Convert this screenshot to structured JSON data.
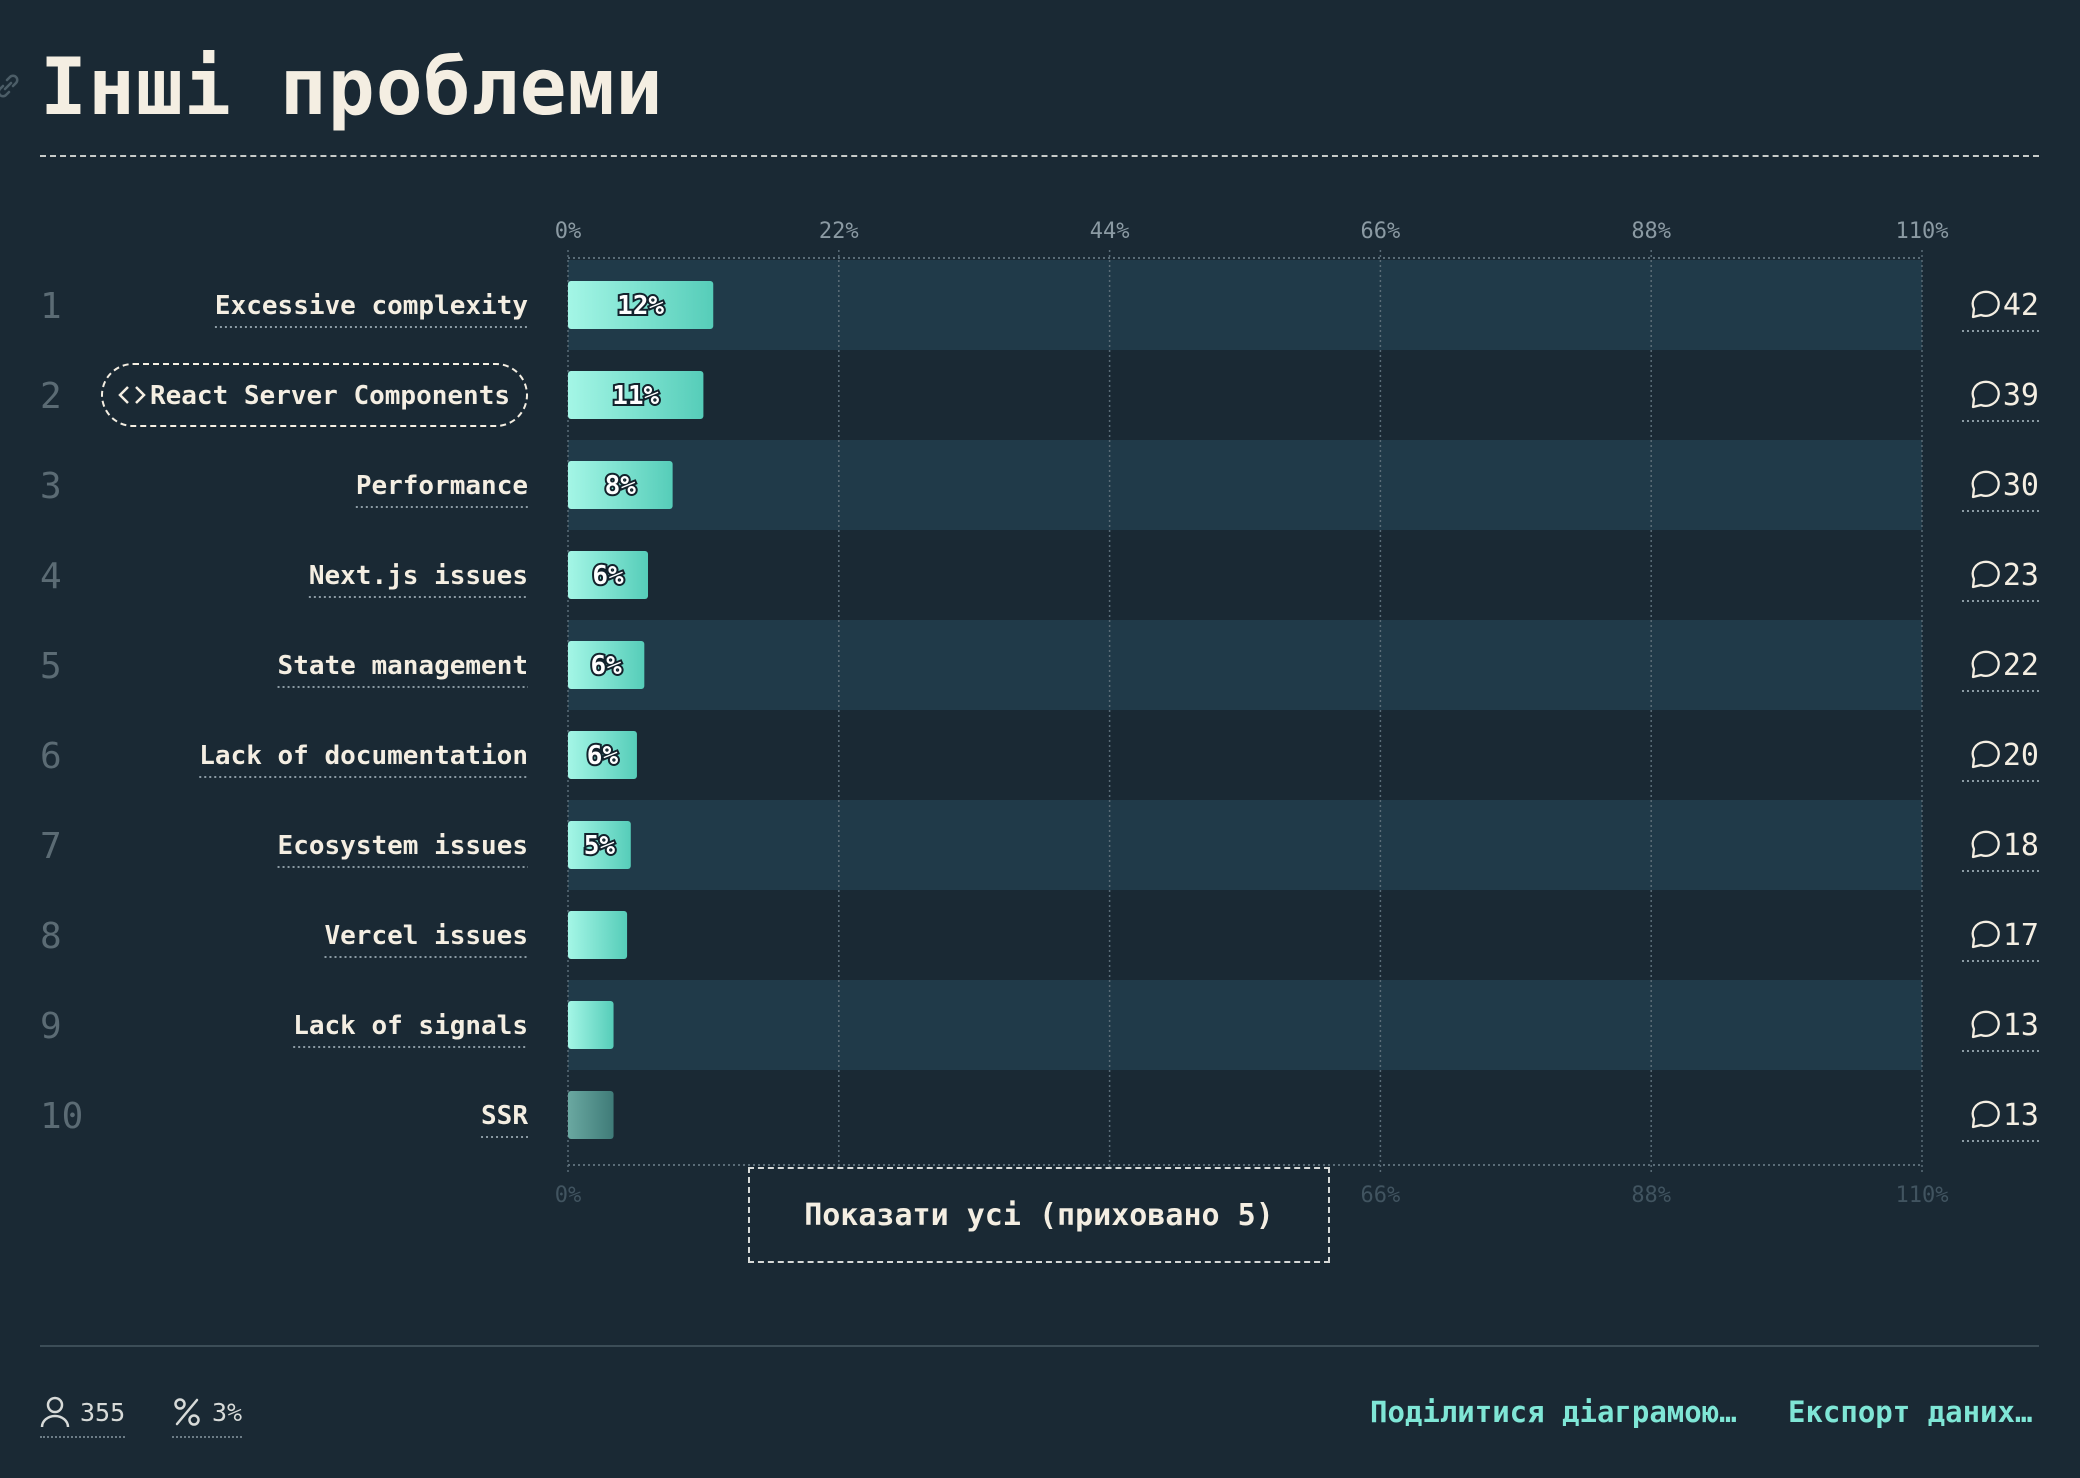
{
  "page": {
    "title": "Інші проблеми",
    "show_all_label": "Показати усі (приховано 5)",
    "footer": {
      "respondents": "355",
      "percent": "3%",
      "share_label": "Поділитися діаграмою…",
      "export_label": "Експорт даних…"
    }
  },
  "chart_data": {
    "type": "bar",
    "orientation": "horizontal",
    "unit": "%",
    "xlim": [
      0,
      110
    ],
    "ticks": [
      "0%",
      "22%",
      "44%",
      "66%",
      "88%",
      "110%"
    ],
    "tick_values": [
      0,
      22,
      44,
      66,
      88,
      110
    ],
    "grid": true,
    "categories": [
      "Excessive complexity",
      "React Server Components",
      "Performance",
      "Next.js issues",
      "State management",
      "Lack of documentation",
      "Ecosystem issues",
      "Vercel issues",
      "Lack of signals",
      "SSR"
    ],
    "ranks": [
      "1",
      "2",
      "3",
      "4",
      "5",
      "6",
      "7",
      "8",
      "9",
      "10"
    ],
    "values": [
      11.8,
      11,
      8.5,
      6.5,
      6.2,
      5.6,
      5.1,
      4.8,
      3.7,
      3.7
    ],
    "value_labels": [
      "12%",
      "11%",
      "8%",
      "6%",
      "6%",
      "6%",
      "5%",
      "",
      "",
      ""
    ],
    "counts": [
      "42",
      "39",
      "30",
      "23",
      "22",
      "20",
      "18",
      "17",
      "13",
      "13"
    ],
    "highlighted": "React Server Components",
    "colors": {
      "bar_start": "#a4f6e6",
      "bar_end": "#56cdb9",
      "bar_dim_start": "#6aa8a1",
      "bar_dim_end": "#3f7b78",
      "band": "#203a49",
      "grid": "#5a6c77"
    }
  }
}
